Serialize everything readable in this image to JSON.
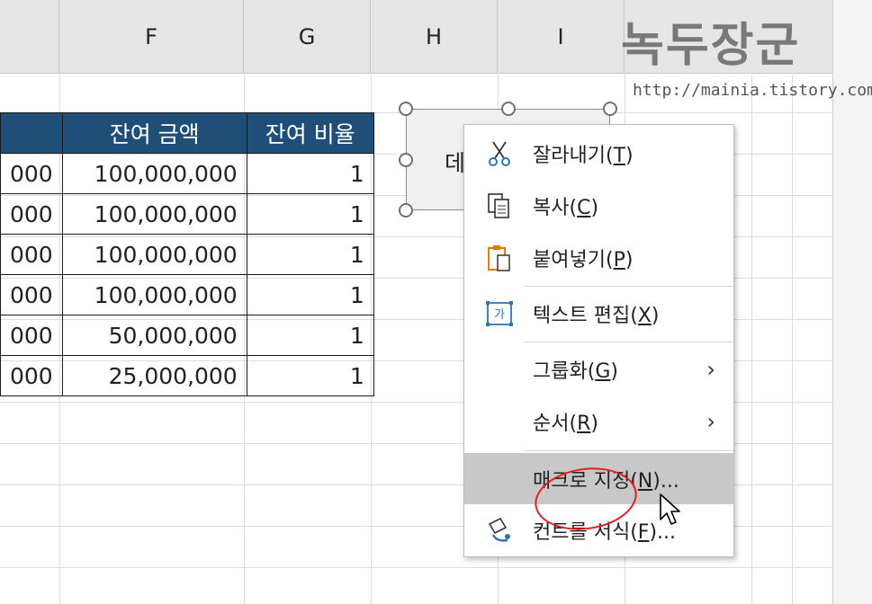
{
  "columns": [
    "F",
    "G",
    "H",
    "I"
  ],
  "table": {
    "headers": [
      "잔여 금액",
      "잔여 비율"
    ],
    "rows": [
      {
        "prev": "000",
        "amount": "100,000,000",
        "ratio": "1"
      },
      {
        "prev": "000",
        "amount": "100,000,000",
        "ratio": "1"
      },
      {
        "prev": "000",
        "amount": "100,000,000",
        "ratio": "1"
      },
      {
        "prev": "000",
        "amount": "100,000,000",
        "ratio": "1"
      },
      {
        "prev": "000",
        "amount": "50,000,000",
        "ratio": "1"
      },
      {
        "prev": "000",
        "amount": "25,000,000",
        "ratio": "1"
      }
    ]
  },
  "shape": {
    "text": "데"
  },
  "context_menu": {
    "items": [
      {
        "label": "잘라내기",
        "key": "T",
        "icon": "scissors-icon"
      },
      {
        "label": "복사",
        "key": "C",
        "icon": "copy-icon"
      },
      {
        "label": "붙여넣기",
        "key": "P",
        "icon": "paste-icon"
      },
      {
        "label": "텍스트 편집",
        "key": "X",
        "icon": "text-edit-icon"
      },
      {
        "label": "그룹화",
        "key": "G",
        "icon": "",
        "submenu": true
      },
      {
        "label": "순서",
        "key": "R",
        "icon": "",
        "submenu": true
      },
      {
        "label": "매크로 지정",
        "key": "N",
        "suffix": "...",
        "icon": "",
        "highlighted": true
      },
      {
        "label": "컨트롤 서식",
        "key": "F",
        "suffix": "...",
        "icon": "format-control-icon"
      }
    ]
  },
  "watermark": {
    "title": "녹두장군",
    "url": "http://mainia.tistory.com"
  },
  "colors": {
    "header_fill": "#1f4e79",
    "highlight": "#c8c8c8",
    "annotation": "#e02020"
  }
}
